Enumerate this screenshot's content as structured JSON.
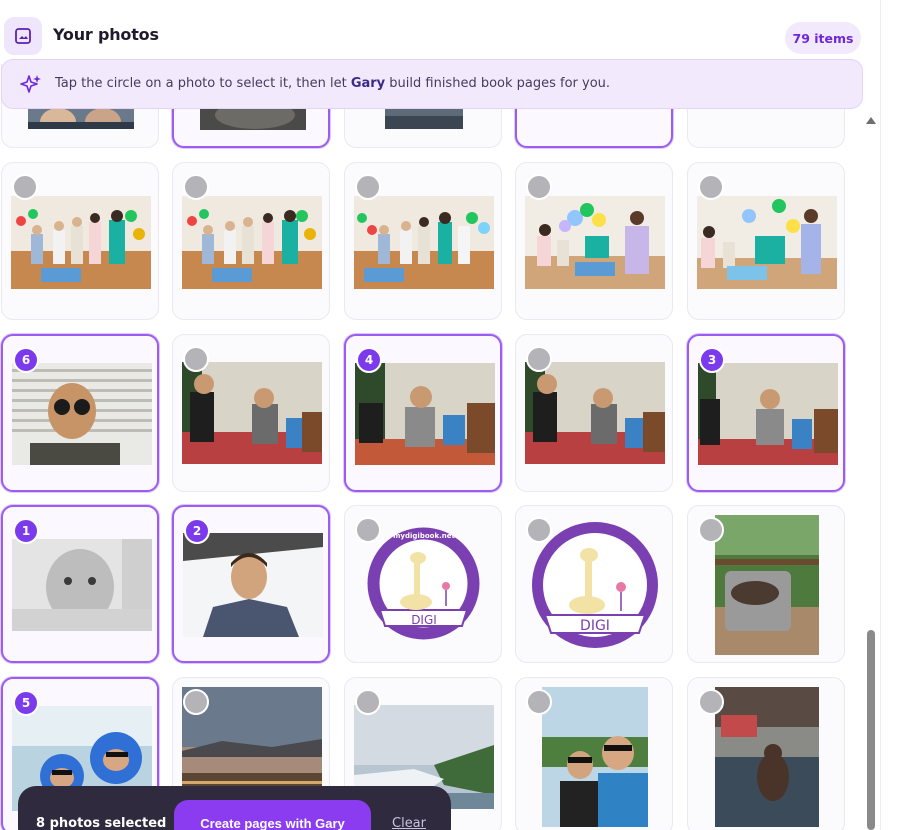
{
  "header": {
    "title": "Your photos",
    "item_count": "79 items",
    "icon": "image-icon"
  },
  "info_banner": {
    "icon": "sparkle-icon",
    "text_before": "Tap the circle on a photo to select it, then let ",
    "assistant_name": "Gary",
    "text_after": " build finished book pages for you."
  },
  "badges": {
    "card_6": "6",
    "card_4": "4",
    "card_3": "3",
    "card_1": "1",
    "card_2": "2",
    "card_5": "5"
  },
  "logo": {
    "url_text": "mydigibook.net",
    "name": "DIGI"
  },
  "action_bar": {
    "selected_text": "8 photos selected",
    "create_label": "Create pages with Gary",
    "clear_label": "Clear"
  },
  "colors": {
    "accent": "#7c3aed",
    "accent_light": "#f2eafc",
    "action_bar_bg": "#2f2a3d"
  }
}
